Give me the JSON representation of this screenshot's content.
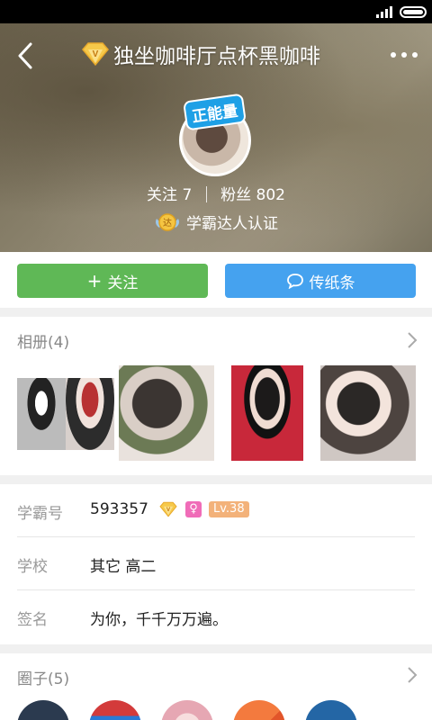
{
  "header": {
    "title": "独坐咖啡厅点杯黑咖啡"
  },
  "profile": {
    "badge_text": "正能量",
    "following_label": "关注 7",
    "followers_label": "粉丝 802",
    "certification": "学霸达人认证"
  },
  "actions": {
    "follow_label": "关注",
    "message_label": "传纸条"
  },
  "album": {
    "title": "相册(4)"
  },
  "info": {
    "id_label": "学霸号",
    "id_value": "593357",
    "sex_symbol": "♀",
    "level": "Lv.38",
    "school_label": "学校",
    "school_value": "其它 高二",
    "signature_label": "签名",
    "signature_value": "为你，千千万万遍。"
  },
  "circles": {
    "title": "圈子(5)"
  },
  "colors": {
    "follow_button": "#5fb856",
    "message_button": "#45a2ef",
    "level_badge": "#f3b27a",
    "sex_badge": "#f06cb8",
    "badge_blue": "#1ea0e6"
  }
}
